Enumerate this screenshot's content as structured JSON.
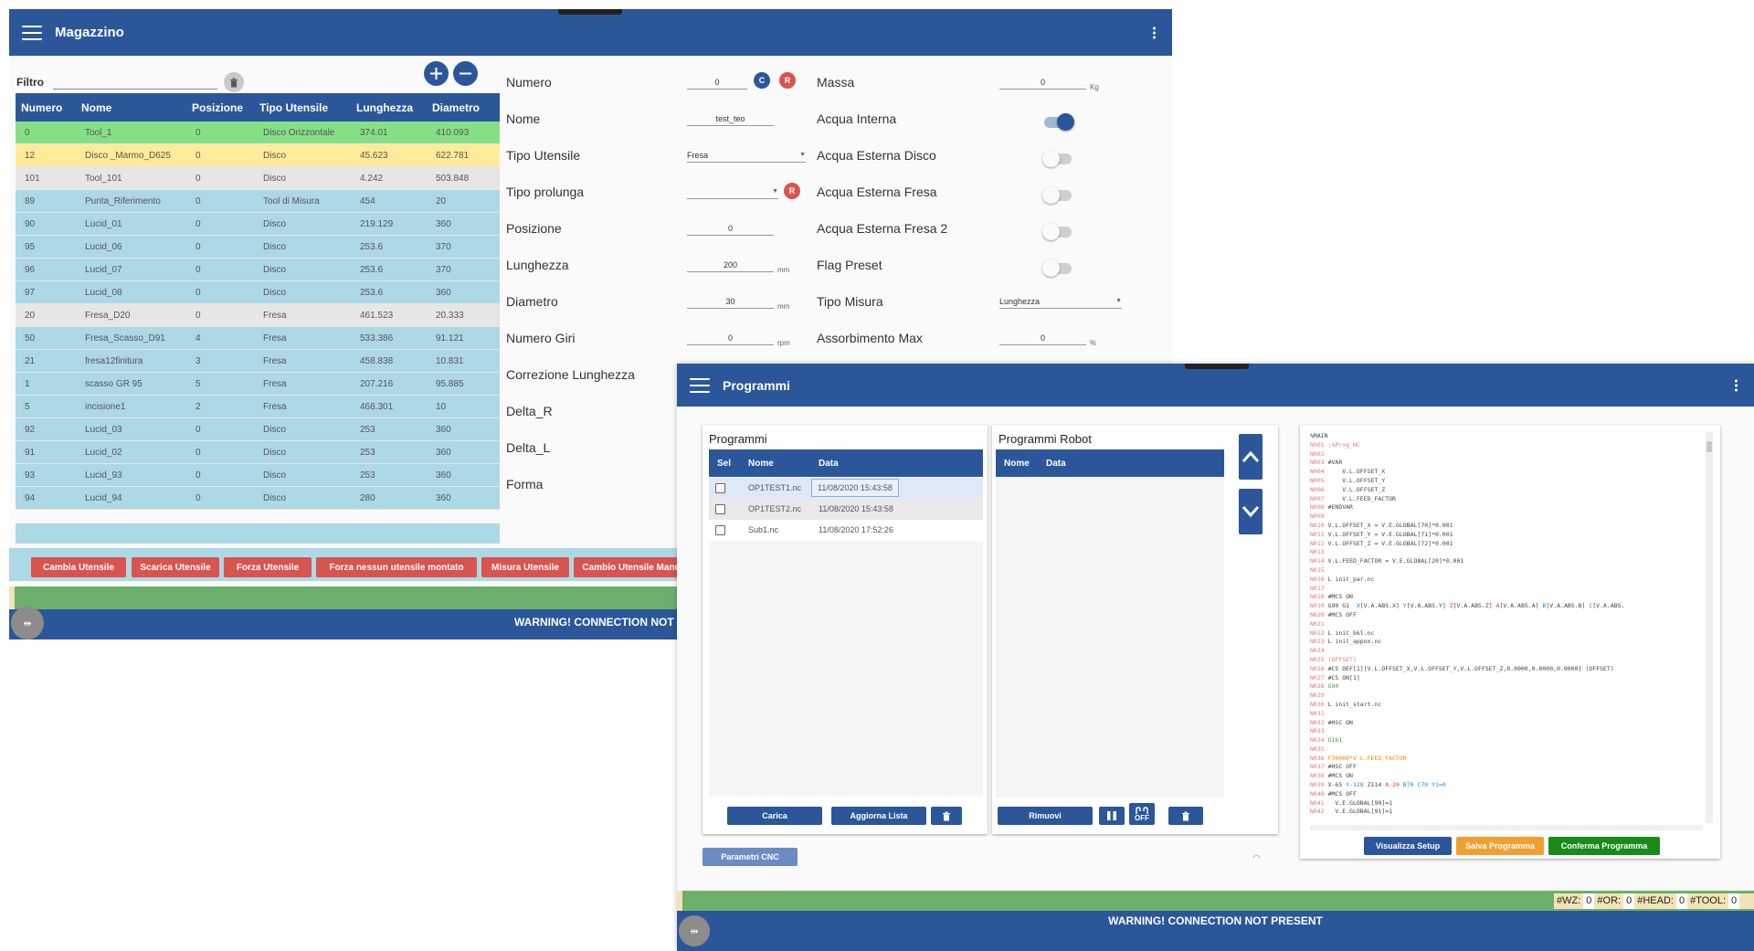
{
  "magazzino": {
    "title": "Magazzino",
    "filter": {
      "label": "Filtro",
      "value": "",
      "placeholder": ""
    },
    "table": {
      "headers": [
        "Numero",
        "Nome",
        "Posizione",
        "Tipo Utensile",
        "Lunghezza",
        "Diametro"
      ],
      "rows": [
        {
          "numero": "0",
          "nome": "Tool_1",
          "pos": "0",
          "tipo": "Disco Orizzontale",
          "lung": "374.01",
          "diam": "410.093",
          "state": "green"
        },
        {
          "numero": "12",
          "nome": "Disco _Marmo_D625",
          "pos": "0",
          "tipo": "Disco",
          "lung": "45.623",
          "diam": "622.781",
          "state": "yellow"
        },
        {
          "numero": "101",
          "nome": "Tool_101",
          "pos": "0",
          "tipo": "Disco",
          "lung": "4.242",
          "diam": "503.848",
          "state": "gray"
        },
        {
          "numero": "89",
          "nome": "Punta_Riferimento",
          "pos": "0",
          "tipo": "Tool di Misura",
          "lung": "454",
          "diam": "20",
          "state": "blue"
        },
        {
          "numero": "90",
          "nome": "Lucid_01",
          "pos": "0",
          "tipo": "Disco",
          "lung": "219.129",
          "diam": "360",
          "state": "blue"
        },
        {
          "numero": "95",
          "nome": "Lucid_06",
          "pos": "0",
          "tipo": "Disco",
          "lung": "253.6",
          "diam": "370",
          "state": "blue"
        },
        {
          "numero": "96",
          "nome": "Lucid_07",
          "pos": "0",
          "tipo": "Disco",
          "lung": "253.6",
          "diam": "370",
          "state": "blue"
        },
        {
          "numero": "97",
          "nome": "Lucid_08",
          "pos": "0",
          "tipo": "Disco",
          "lung": "253.6",
          "diam": "360",
          "state": "blue"
        },
        {
          "numero": "20",
          "nome": "Fresa_D20",
          "pos": "0",
          "tipo": "Fresa",
          "lung": "461.523",
          "diam": "20.333",
          "state": "gray"
        },
        {
          "numero": "50",
          "nome": "Fresa_Scasso_D91",
          "pos": "4",
          "tipo": "Fresa",
          "lung": "533.386",
          "diam": "91.121",
          "state": "blue"
        },
        {
          "numero": "21",
          "nome": "fresa12finitura",
          "pos": "3",
          "tipo": "Fresa",
          "lung": "458.838",
          "diam": "10.831",
          "state": "blue"
        },
        {
          "numero": "1",
          "nome": "scasso GR 95",
          "pos": "5",
          "tipo": "Fresa",
          "lung": "207.216",
          "diam": "95.885",
          "state": "blue"
        },
        {
          "numero": "5",
          "nome": "incisione1",
          "pos": "2",
          "tipo": "Fresa",
          "lung": "468.301",
          "diam": "10",
          "state": "blue"
        },
        {
          "numero": "92",
          "nome": "Lucid_03",
          "pos": "0",
          "tipo": "Disco",
          "lung": "253",
          "diam": "360",
          "state": "blue"
        },
        {
          "numero": "91",
          "nome": "Lucid_02",
          "pos": "0",
          "tipo": "Disco",
          "lung": "253",
          "diam": "360",
          "state": "blue"
        },
        {
          "numero": "93",
          "nome": "Lucid_93",
          "pos": "0",
          "tipo": "Disco",
          "lung": "253",
          "diam": "360",
          "state": "blue"
        },
        {
          "numero": "94",
          "nome": "Lucid_94",
          "pos": "0",
          "tipo": "Disco",
          "lung": "280",
          "diam": "360",
          "state": "blue"
        }
      ]
    },
    "form": {
      "numero": {
        "label": "Numero",
        "value": "0",
        "c": "C",
        "r": "R"
      },
      "nome": {
        "label": "Nome",
        "value": "test_teo"
      },
      "tipo_utensile": {
        "label": "Tipo Utensile",
        "value": "Fresa"
      },
      "tipo_prolunga": {
        "label": "Tipo prolunga",
        "value": "",
        "r": "R"
      },
      "posizione": {
        "label": "Posizione",
        "value": "0"
      },
      "lunghezza": {
        "label": "Lunghezza",
        "value": "200",
        "unit": "mm"
      },
      "diametro": {
        "label": "Diametro",
        "value": "30",
        "unit": "mm"
      },
      "numero_giri": {
        "label": "Numero Giri",
        "value": "0",
        "unit": "rpm"
      },
      "correzione_lunghezza": {
        "label": "Correzione Lunghezza"
      },
      "delta_r": {
        "label": "Delta_R"
      },
      "delta_l": {
        "label": "Delta_L"
      },
      "forma": {
        "label": "Forma"
      },
      "massa": {
        "label": "Massa",
        "value": "0",
        "unit": "Kg"
      },
      "acqua_interna": {
        "label": "Acqua Interna",
        "on": true
      },
      "acqua_esterna_disco": {
        "label": "Acqua Esterna Disco",
        "on": false
      },
      "acqua_esterna_fresa": {
        "label": "Acqua Esterna Fresa",
        "on": false
      },
      "acqua_esterna_fresa2": {
        "label": "Acqua Esterna Fresa 2",
        "on": false
      },
      "flag_preset": {
        "label": "Flag Preset",
        "on": false
      },
      "tipo_misura": {
        "label": "Tipo Misura",
        "value": "Lunghezza"
      },
      "assorbimento_max": {
        "label": "Assorbimento Max",
        "value": "0",
        "unit": "%"
      }
    },
    "actions": [
      "Cambia Utensile",
      "Scarica Utensile",
      "Forza Utensile",
      "Forza nessun utensile montato",
      "Misura Utensile",
      "Cambio Utensile Manuale"
    ],
    "warning": "WARNING! CONNECTION NOT PRESENT",
    "grip_icon": "⇹"
  },
  "programmi": {
    "title": "Programmi",
    "programs_card": {
      "title": "Programmi",
      "headers": {
        "sel": "Sel",
        "nome": "Nome",
        "data": "Data"
      },
      "rows": [
        {
          "nome": "OP1TEST1.nc",
          "data": "11/08/2020 15:43:58"
        },
        {
          "nome": "OP1TEST2.nc",
          "data": "11/08/2020 15:43:58"
        },
        {
          "nome": "Sub1.nc",
          "data": "11/08/2020 17:52:26"
        }
      ],
      "carica": "Carica",
      "aggiorna": "Aggiorna Lista"
    },
    "robot_card": {
      "title": "Programmi Robot",
      "headers": {
        "nome": "Nome",
        "data": "Data"
      },
      "rimuovi": "Rimuovi",
      "off_label": "OFF"
    },
    "code_lines": [
      [
        [
          "",
          "%MAIN"
        ]
      ],
      [
        [
          "ln",
          "N001 "
        ],
        [
          "ln",
          ";%Prog_NC"
        ]
      ],
      [
        [
          "ln",
          "N002"
        ]
      ],
      [
        [
          "ln",
          "N003 "
        ],
        [
          "",
          "#VAR"
        ]
      ],
      [
        [
          "ln",
          "N004 "
        ],
        [
          "",
          "    V.L.OFFSET_X"
        ]
      ],
      [
        [
          "ln",
          "N005 "
        ],
        [
          "",
          "    V.L.OFFSET_Y"
        ]
      ],
      [
        [
          "ln",
          "N006 "
        ],
        [
          "",
          "    V.L.OFFSET_Z"
        ]
      ],
      [
        [
          "ln",
          "N007 "
        ],
        [
          "",
          "    V.L.FEED_FACTOR"
        ]
      ],
      [
        [
          "ln",
          "N008 "
        ],
        [
          "",
          "#ENDVAR"
        ]
      ],
      [
        [
          "ln",
          "N009"
        ]
      ],
      [
        [
          "ln",
          "N010 "
        ],
        [
          "",
          "V.L.OFFSET_X = V.E.GLOBAL[70]*0.001"
        ]
      ],
      [
        [
          "ln",
          "N011 "
        ],
        [
          "",
          "V.L.OFFSET_Y = V.E.GLOBAL[71]*0.001"
        ]
      ],
      [
        [
          "ln",
          "N012 "
        ],
        [
          "",
          "V.L.OFFSET_Z = V.E.GLOBAL[72]*0.001"
        ]
      ],
      [
        [
          "ln",
          "N013"
        ]
      ],
      [
        [
          "ln",
          "N014 "
        ],
        [
          "",
          "V.L.FEED_FACTOR = V.E.GLOBAL[20]*0.001"
        ]
      ],
      [
        [
          "ln",
          "N015"
        ]
      ],
      [
        [
          "ln",
          "N016 "
        ],
        [
          "",
          "L init_par.nc"
        ]
      ],
      [
        [
          "ln",
          "N017"
        ]
      ],
      [
        [
          "ln",
          "N018 "
        ],
        [
          "",
          "#MCS ON"
        ]
      ],
      [
        [
          "ln",
          "N019 "
        ],
        [
          "",
          "G90 G1  "
        ],
        [
          "kx",
          "X"
        ],
        [
          "",
          "[V.A.ABS.X] "
        ],
        [
          "kx",
          "Y"
        ],
        [
          "",
          "[V.A.ABS.Y] "
        ],
        [
          "kz",
          "Z"
        ],
        [
          "",
          "[V.A.ABS.Z] "
        ],
        [
          "kz",
          "A"
        ],
        [
          "",
          "[V.A.ABS.A] "
        ],
        [
          "kx",
          "B"
        ],
        [
          "",
          "[V.A.ABS.B] "
        ],
        [
          "kx",
          "C"
        ],
        [
          "",
          "[V.A.ABS."
        ]
      ],
      [
        [
          "ln",
          "N020 "
        ],
        [
          "",
          "#MCS OFF"
        ]
      ],
      [
        [
          "ln",
          "N021"
        ]
      ],
      [
        [
          "ln",
          "N022 "
        ],
        [
          "",
          "L init_bkl.nc"
        ]
      ],
      [
        [
          "ln",
          "N023 "
        ],
        [
          "",
          "L init_appox.nc"
        ]
      ],
      [
        [
          "ln",
          "N024"
        ]
      ],
      [
        [
          "ln",
          "N025 "
        ],
        [
          "ln",
          "(OFFSET)"
        ]
      ],
      [
        [
          "ln",
          "N026 "
        ],
        [
          "",
          "#CS DEF[1][V.L.OFFSET_X,V.L.OFFSET_Y,V.L.OFFSET_Z,0.0000,0.0000,0.0000] (OFFSET)"
        ]
      ],
      [
        [
          "ln",
          "N027 "
        ],
        [
          "",
          "#CS ON[1]"
        ]
      ],
      [
        [
          "ln",
          "N028 "
        ],
        [
          "kg",
          "G90"
        ]
      ],
      [
        [
          "ln",
          "N029"
        ]
      ],
      [
        [
          "ln",
          "N030 "
        ],
        [
          "",
          "L init_start.nc"
        ]
      ],
      [
        [
          "ln",
          "N031"
        ]
      ],
      [
        [
          "ln",
          "N032 "
        ],
        [
          "",
          "#HSC ON"
        ]
      ],
      [
        [
          "ln",
          "N033"
        ]
      ],
      [
        [
          "ln",
          "N034 "
        ],
        [
          "kg",
          "G161"
        ]
      ],
      [
        [
          "ln",
          "N035"
        ]
      ],
      [
        [
          "ln",
          "N036 "
        ],
        [
          "ko",
          "F30000*V.L.FEED_FACTOR"
        ]
      ],
      [
        [
          "ln",
          "N037 "
        ],
        [
          "",
          "#HSC OFF"
        ]
      ],
      [
        [
          "ln",
          "N038 "
        ],
        [
          "",
          "#MCS ON"
        ]
      ],
      [
        [
          "ln",
          "N039 "
        ],
        [
          "",
          "X-65 "
        ],
        [
          "kx",
          "Y-128 "
        ],
        [
          "",
          "Z114 "
        ],
        [
          "kz",
          "A-20 "
        ],
        [
          "kx",
          "B70 "
        ],
        [
          "kx",
          "C70 "
        ],
        [
          "kx",
          "Y1=0"
        ]
      ],
      [
        [
          "ln",
          "N040 "
        ],
        [
          "",
          "#MCS OFF"
        ]
      ],
      [
        [
          "ln",
          "N041 "
        ],
        [
          "",
          "  V.E.GLOBAL[90]=1"
        ]
      ],
      [
        [
          "ln",
          "N042 "
        ],
        [
          "",
          "  V.E.GLOBAL[91]=1"
        ]
      ]
    ],
    "visualizza_setup": "Visualizza Setup",
    "salva_programma": "Salva Programma",
    "conferma_programma": "Conferma Programma",
    "parametri_cnc": "Parametri CNC",
    "status": {
      "wz_label": "#WZ:",
      "wz": "0",
      "or_label": "#OR:",
      "or": "0",
      "head_label": "#HEAD:",
      "head": "0",
      "tool_label": "#TOOL:",
      "tool": "0"
    },
    "warning": "WARNING! CONNECTION NOT PRESENT",
    "grip_icon": "⇹"
  }
}
